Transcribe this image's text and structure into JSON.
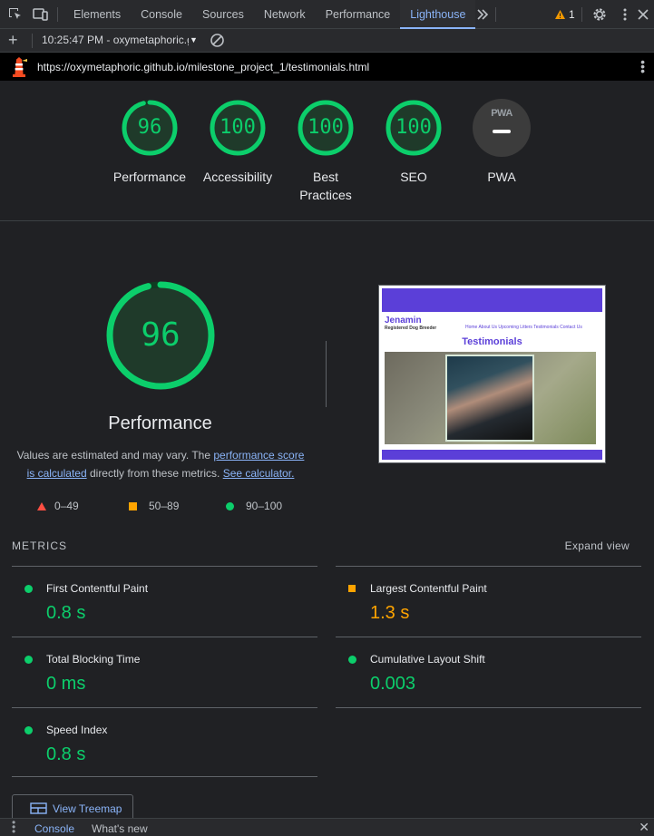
{
  "devtools": {
    "tabs": [
      "Elements",
      "Console",
      "Sources",
      "Network",
      "Performance",
      "Lighthouse"
    ],
    "active_tab": "Lighthouse",
    "warning_count": "1"
  },
  "toolbar": {
    "report_label": "10:25:47 PM - oxymetaphoric.g"
  },
  "page_url": "https://oxymetaphoric.github.io/milestone_project_1/testimonials.html",
  "summary": {
    "performance": {
      "score": "96",
      "label": "Performance",
      "value": 0.96
    },
    "accessibility": {
      "score": "100",
      "label": "Accessibility",
      "value": 1.0
    },
    "best_practices": {
      "score": "100",
      "label_line1": "Best",
      "label_line2": "Practices",
      "value": 1.0
    },
    "seo": {
      "score": "100",
      "label": "SEO",
      "value": 1.0
    },
    "pwa": {
      "badge": "PWA",
      "label": "PWA"
    }
  },
  "performance_section": {
    "score": "96",
    "value": 0.96,
    "title": "Performance",
    "desc_text1": "Values are estimated and may vary. The ",
    "desc_link1": "performance score is calculated",
    "desc_text2": " directly from these metrics. ",
    "desc_link2": "See calculator.",
    "legend": [
      "0–49",
      "50–89",
      "90–100"
    ]
  },
  "screenshot": {
    "brand": "Jenamin",
    "subtitle": "Registered Dog Breeder",
    "nav": "Home  About Us  Upcoming Litters  Testimonials  Contact Us",
    "heading": "Testimonials"
  },
  "metrics": {
    "heading": "METRICS",
    "expand_label": "Expand view",
    "fcp": {
      "name": "First Contentful Paint",
      "value": "0.8 s"
    },
    "lcp": {
      "name": "Largest Contentful Paint",
      "value": "1.3 s"
    },
    "tbt": {
      "name": "Total Blocking Time",
      "value": "0 ms"
    },
    "cls": {
      "name": "Cumulative Layout Shift",
      "value": "0.003"
    },
    "si": {
      "name": "Speed Index",
      "value": "0.8 s"
    }
  },
  "treemap_label": "View Treemap",
  "drawer": {
    "tabs": [
      "Console",
      "What's new"
    ]
  },
  "colors": {
    "pass": "#0cce6b",
    "average": "#ffa400",
    "fail": "#ff4e42",
    "link": "#8ab4f8"
  }
}
